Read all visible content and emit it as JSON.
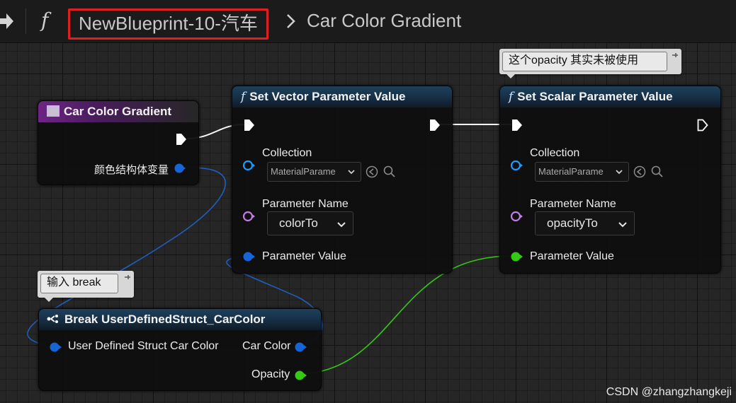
{
  "breadcrumb": {
    "blueprint_name": "NewBlueprint-10-汽车",
    "function_name": "Car Color Gradient",
    "function_glyph": "f"
  },
  "nodes": {
    "entry": {
      "title": "Car Color Gradient",
      "output_label": "颜色结构体变量",
      "icon": "function-entry-icon"
    },
    "set_vector": {
      "title": "Set Vector Parameter Value",
      "collection_label": "Collection",
      "collection_value": "MaterialParame",
      "param_name_label": "Parameter Name",
      "param_name_value": "colorTo",
      "param_value_label": "Parameter Value"
    },
    "set_scalar": {
      "title": "Set Scalar Parameter Value",
      "collection_label": "Collection",
      "collection_value": "MaterialParame",
      "param_name_label": "Parameter Name",
      "param_name_value": "opacityTo",
      "param_value_label": "Parameter Value"
    },
    "break_struct": {
      "title": "Break UserDefinedStruct_CarColor",
      "input_label": "User Defined Struct Car Color",
      "out_color_label": "Car Color",
      "out_opacity_label": "Opacity"
    }
  },
  "comments": {
    "scalar_note": "这个opacity 其实未被使用",
    "break_note": "输入 break"
  },
  "watermark": "CSDN @zhangzhangkeji",
  "colors": {
    "struct_pin": "#1565d8",
    "object_pin": "#1a9bff",
    "name_pin": "#c07be6",
    "float_pin": "#35c814",
    "exec": "#ffffff",
    "highlight": "#e02020"
  }
}
